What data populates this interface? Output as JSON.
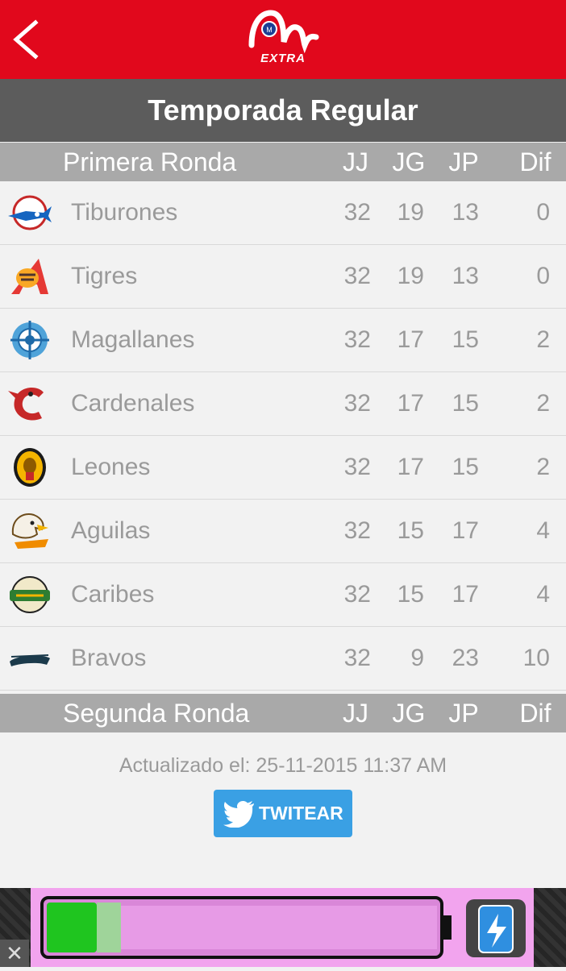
{
  "header": {
    "logo_text": "EXTRA",
    "colors": {
      "brand_red": "#e1081c",
      "title_bar": "#5c5c5c",
      "section_bar": "#a9a9a9"
    }
  },
  "title": "Temporada Regular",
  "columns": {
    "jj": "JJ",
    "jg": "JG",
    "jp": "JP",
    "dif": "Dif"
  },
  "first_round": {
    "label": "Primera Ronda",
    "rows": [
      {
        "team": "Tiburones",
        "icon": "tiburones-logo-icon",
        "jj": "32",
        "jg": "19",
        "jp": "13",
        "dif": "0"
      },
      {
        "team": "Tigres",
        "icon": "tigres-logo-icon",
        "jj": "32",
        "jg": "19",
        "jp": "13",
        "dif": "0"
      },
      {
        "team": "Magallanes",
        "icon": "magallanes-logo-icon",
        "jj": "32",
        "jg": "17",
        "jp": "15",
        "dif": "2"
      },
      {
        "team": "Cardenales",
        "icon": "cardenales-logo-icon",
        "jj": "32",
        "jg": "17",
        "jp": "15",
        "dif": "2"
      },
      {
        "team": "Leones",
        "icon": "leones-logo-icon",
        "jj": "32",
        "jg": "17",
        "jp": "15",
        "dif": "2"
      },
      {
        "team": "Aguilas",
        "icon": "aguilas-logo-icon",
        "jj": "32",
        "jg": "15",
        "jp": "17",
        "dif": "4"
      },
      {
        "team": "Caribes",
        "icon": "caribes-logo-icon",
        "jj": "32",
        "jg": "15",
        "jp": "17",
        "dif": "4"
      },
      {
        "team": "Bravos",
        "icon": "bravos-logo-icon",
        "jj": "32",
        "jg": "9",
        "jp": "23",
        "dif": "10"
      }
    ]
  },
  "second_round": {
    "label": "Segunda Ronda"
  },
  "updated": "Actualizado el: 25-11-2015 11:37 AM",
  "tweet_button": {
    "label": "TWITEAR",
    "color": "#3aa0e4"
  },
  "ad": {
    "close_label": "✕"
  }
}
